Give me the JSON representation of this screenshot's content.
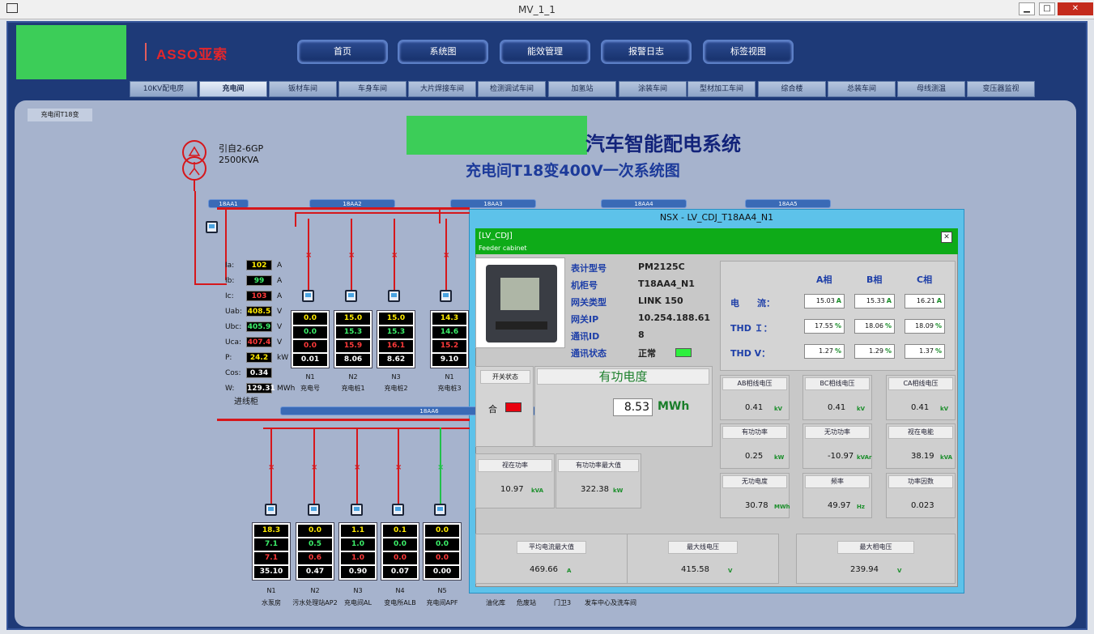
{
  "window": {
    "title": "MV_1_1",
    "min": "▁",
    "max": "□",
    "close": "✕"
  },
  "logo": {
    "text": "ASSO亚索"
  },
  "nav": [
    {
      "label": "首页"
    },
    {
      "label": "系统图"
    },
    {
      "label": "能效管理"
    },
    {
      "label": "报警日志"
    },
    {
      "label": "标签视图"
    }
  ],
  "tabs": [
    {
      "label": "10KV配电房"
    },
    {
      "label": "充电间"
    },
    {
      "label": "钣材车间"
    },
    {
      "label": "车身车间"
    },
    {
      "label": "大片焊接车间"
    },
    {
      "label": "检测调试车间"
    },
    {
      "label": "加氢站"
    },
    {
      "label": "涂装车间"
    },
    {
      "label": "型材加工车间"
    },
    {
      "label": "综合楼"
    },
    {
      "label": "总装车间"
    },
    {
      "label": "母线测温"
    },
    {
      "label": "变压器监视"
    }
  ],
  "crumb": "充电间T18变",
  "title": {
    "main": "汽车智能配电系统",
    "sub": "充电间T18变400V一次系统图"
  },
  "transformer": {
    "source": "引自2-6GP",
    "capacity": "2500KVA"
  },
  "buses": [
    "18AA1",
    "18AA2",
    "18AA3",
    "18AA4",
    "18AA5",
    "18AA6"
  ],
  "incoming": {
    "rows": [
      {
        "label": "Ia:",
        "value": "102",
        "unit": "A",
        "color": "y"
      },
      {
        "label": "Ib:",
        "value": "99",
        "unit": "A",
        "color": "g"
      },
      {
        "label": "Ic:",
        "value": "103",
        "unit": "A",
        "color": "r"
      },
      {
        "label": "Uab:",
        "value": "408.5",
        "unit": "V",
        "color": "y"
      },
      {
        "label": "Ubc:",
        "value": "405.9",
        "unit": "V",
        "color": "g"
      },
      {
        "label": "Uca:",
        "value": "407.4",
        "unit": "V",
        "color": "r"
      },
      {
        "label": "P:",
        "value": "24.2",
        "unit": "kW",
        "color": "y"
      },
      {
        "label": "Cos:",
        "value": "0.34",
        "unit": "",
        "color": "w"
      },
      {
        "label": "W:",
        "value": "129.31",
        "unit": "MWh",
        "color": "w"
      }
    ],
    "name": "进线柜"
  },
  "top_feeders": [
    {
      "vals": [
        "0.0",
        "0.0",
        "0.0",
        "0.01"
      ],
      "n": "N1",
      "name": "充电号"
    },
    {
      "vals": [
        "15.0",
        "15.3",
        "15.9",
        "8.06"
      ],
      "n": "N2",
      "name": "充电桩1"
    },
    {
      "vals": [
        "15.0",
        "15.3",
        "16.1",
        "8.62"
      ],
      "n": "N3",
      "name": "充电桩2"
    },
    {
      "vals": [
        "14.3",
        "14.6",
        "15.2",
        "9.10"
      ],
      "n": "N1",
      "name": "充电桩3"
    }
  ],
  "bottom_feeders": [
    {
      "vals": [
        "18.3",
        "7.1",
        "7.1",
        "35.10"
      ],
      "n": "N1",
      "name": "水泵房"
    },
    {
      "vals": [
        "0.0",
        "0.5",
        "0.6",
        "0.47"
      ],
      "n": "N2",
      "name": "污水处理站AP2"
    },
    {
      "vals": [
        "1.1",
        "1.0",
        "1.0",
        "0.90"
      ],
      "n": "N3",
      "name": "充电间AL"
    },
    {
      "vals": [
        "0.1",
        "0.0",
        "0.0",
        "0.07"
      ],
      "n": "N4",
      "name": "变电所ALB"
    },
    {
      "vals": [
        "0.0",
        "0.0",
        "0.0",
        "0.00"
      ],
      "n": "N5",
      "name": "充电间APF"
    }
  ],
  "bottom_extra": [
    "油化库",
    "危废站",
    "门卫3",
    "发车中心及洗车间"
  ],
  "popup": {
    "title": "NSX - LV_CDJ_T18AA4_N1",
    "tag": "[LV_CDJ]",
    "tag_sub": "Feeder cabinet",
    "close": "✕",
    "info": [
      {
        "label": "表计型号",
        "value": "PM2125C"
      },
      {
        "label": "机柜号",
        "value": "T18AA4_N1"
      },
      {
        "label": "网关类型",
        "value": "LINK 150"
      },
      {
        "label": "网关IP",
        "value": "10.254.188.61"
      },
      {
        "label": "通讯ID",
        "value": "8"
      },
      {
        "label": "通讯状态",
        "value": "正常"
      }
    ],
    "phase_headers": [
      "A相",
      "B相",
      "C相"
    ],
    "phase_rows": [
      {
        "label": "电　　流：",
        "vals": [
          "15.03",
          "15.33",
          "16.21"
        ],
        "unit": "A"
      },
      {
        "label": "THD Ｉ：",
        "vals": [
          "17.55",
          "18.06",
          "18.09"
        ],
        "unit": "%"
      },
      {
        "label": "THD V：",
        "vals": [
          "1.27",
          "1.29",
          "1.37"
        ],
        "unit": "%"
      }
    ],
    "switch_label": "开关状态",
    "switch_state": "合",
    "energy_title": "有功电度",
    "energy_value": "8.53",
    "energy_unit": "MWh",
    "grid": [
      {
        "t": "AB相线电压",
        "v": "0.41",
        "u": "kV"
      },
      {
        "t": "BC相线电压",
        "v": "0.41",
        "u": "kV"
      },
      {
        "t": "CA相线电压",
        "v": "0.41",
        "u": "kV"
      },
      {
        "t": "有功功率",
        "v": "0.25",
        "u": "kW"
      },
      {
        "t": "无功功率",
        "v": "-10.97",
        "u": "kVAr"
      },
      {
        "t": "视在电能",
        "v": "38.19",
        "u": "kVA"
      },
      {
        "t": "无功电度",
        "v": "30.78",
        "u": "MWh"
      },
      {
        "t": "频率",
        "v": "49.97",
        "u": "Hz"
      },
      {
        "t": "功率因数",
        "v": "0.023",
        "u": ""
      }
    ],
    "left_grid": [
      {
        "t": "视在功率",
        "v": "10.97",
        "u": "kVA"
      },
      {
        "t": "有功功率最大值",
        "v": "322.38",
        "u": "kW"
      }
    ],
    "bottom": [
      {
        "t": "平均电流最大值",
        "v": "469.66",
        "u": "A"
      },
      {
        "t": "最大线电压",
        "v": "415.58",
        "u": "V"
      },
      {
        "t": "最大相电压",
        "v": "239.94",
        "u": "V"
      }
    ]
  }
}
